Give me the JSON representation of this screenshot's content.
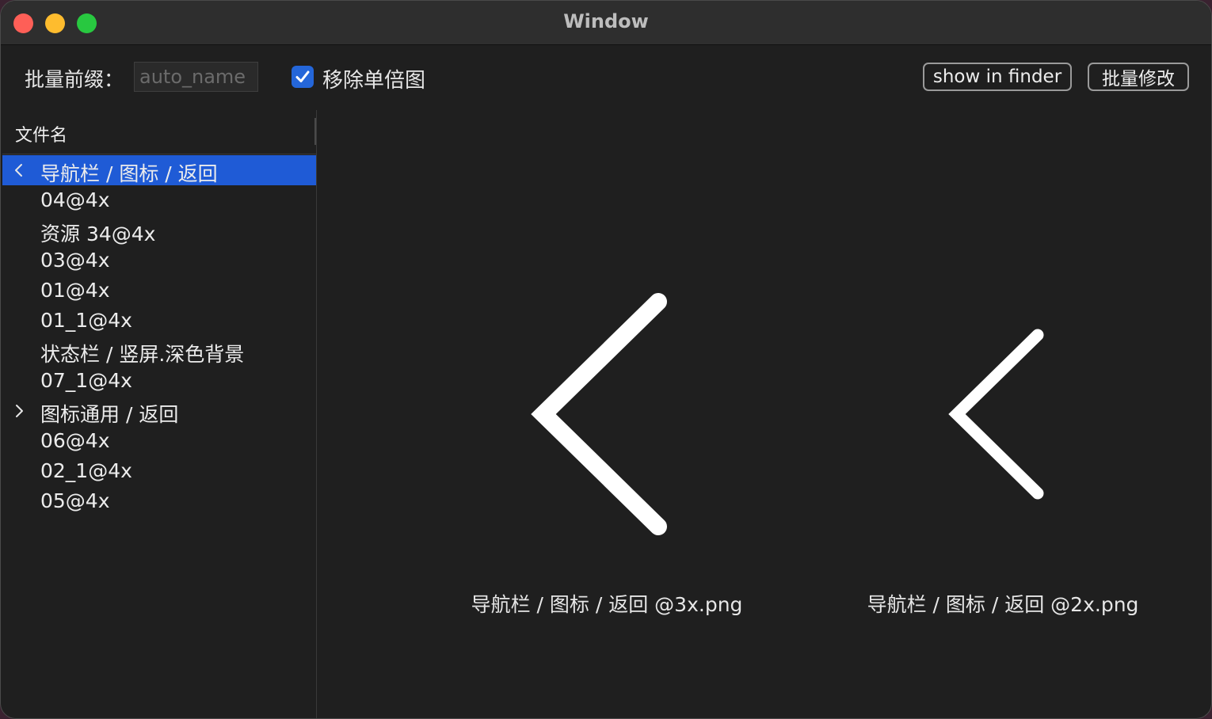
{
  "window": {
    "title": "Window"
  },
  "toolbar": {
    "prefix_label": "批量前缀：",
    "prefix_placeholder": "auto_name",
    "prefix_value": "",
    "remove_single_label": "移除单倍图",
    "remove_single_checked": true,
    "show_in_finder_label": "show in finder",
    "batch_modify_label": "批量修改"
  },
  "sidebar": {
    "column_header": "文件名",
    "items": [
      {
        "label": "导航栏 / 图标 / 返回",
        "disclosure": "chevron-left-icon",
        "selected": true
      },
      {
        "label": "04@4x"
      },
      {
        "label": "资源 34@4x"
      },
      {
        "label": "03@4x"
      },
      {
        "label": "01@4x"
      },
      {
        "label": "01_1@4x"
      },
      {
        "label": "状态栏 / 竖屏.深色背景"
      },
      {
        "label": "07_1@4x"
      },
      {
        "label": "图标通用 / 返回",
        "disclosure": "chevron-right-icon"
      },
      {
        "label": "06@4x"
      },
      {
        "label": "02_1@4x"
      },
      {
        "label": "05@4x"
      }
    ]
  },
  "previews": [
    {
      "icon": "chevron-left-icon",
      "caption": "导航栏 / 图标 / 返回 @3x.png"
    },
    {
      "icon": "chevron-left-icon",
      "caption": "导航栏 / 图标 / 返回 @2x.png"
    }
  ],
  "colors": {
    "accent": "#1f5bd6",
    "checkbox": "#2466d9",
    "background": "#1f1f1f",
    "titlebar": "#2e2e2e"
  }
}
